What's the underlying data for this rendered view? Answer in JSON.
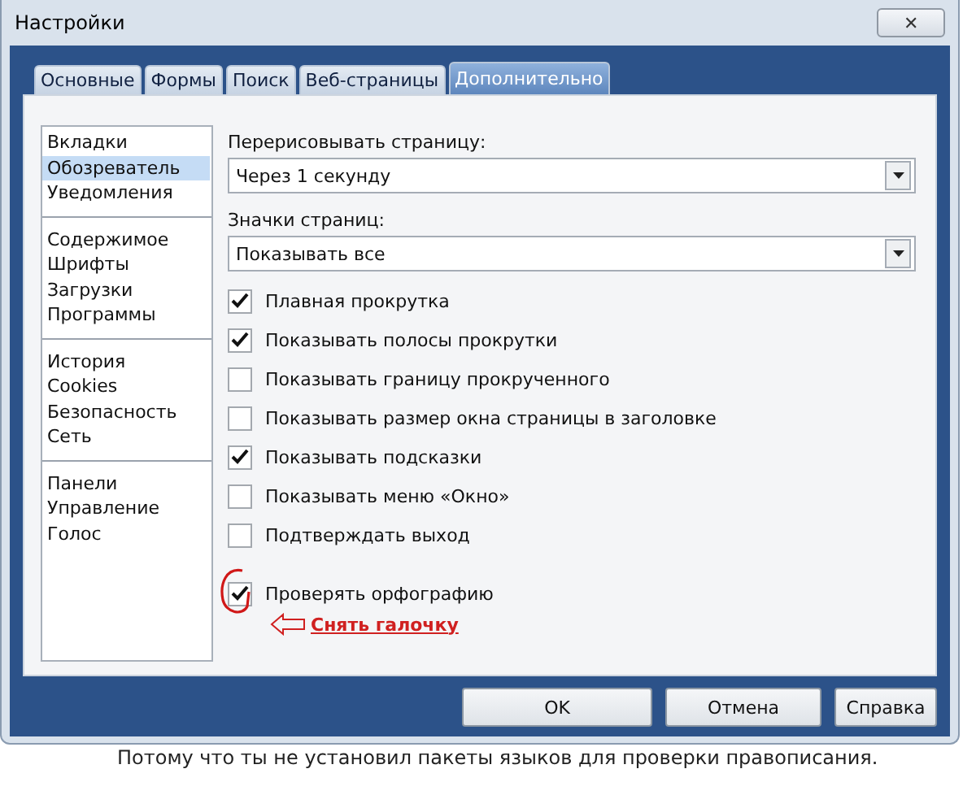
{
  "window": {
    "title": "Настройки",
    "close": "✕"
  },
  "tabs": [
    {
      "label": "Основные",
      "selected": false
    },
    {
      "label": "Формы",
      "selected": false
    },
    {
      "label": "Поиск",
      "selected": false
    },
    {
      "label": "Веб-страницы",
      "selected": false
    },
    {
      "label": "Дополнительно",
      "selected": true
    }
  ],
  "sidebar": {
    "groups": [
      [
        {
          "label": "Вкладки",
          "selected": false
        },
        {
          "label": "Обозреватель",
          "selected": true
        },
        {
          "label": "Уведомления",
          "selected": false
        }
      ],
      [
        {
          "label": "Содержимое",
          "selected": false
        },
        {
          "label": "Шрифты",
          "selected": false
        },
        {
          "label": "Загрузки",
          "selected": false
        },
        {
          "label": "Программы",
          "selected": false
        }
      ],
      [
        {
          "label": "История",
          "selected": false
        },
        {
          "label": "Cookies",
          "selected": false
        },
        {
          "label": "Безопасность",
          "selected": false
        },
        {
          "label": "Сеть",
          "selected": false
        }
      ],
      [
        {
          "label": "Панели",
          "selected": false
        },
        {
          "label": "Управление",
          "selected": false
        },
        {
          "label": "Голос",
          "selected": false
        }
      ]
    ]
  },
  "dropdowns": [
    {
      "label": "Перерисовывать страницу:",
      "value": "Через 1 секунду"
    },
    {
      "label": "Значки страниц:",
      "value": "Показывать все"
    }
  ],
  "checkboxes": [
    {
      "label": "Плавная прокрутка",
      "checked": true,
      "circled": false
    },
    {
      "label": "Показывать полосы прокрутки",
      "checked": true,
      "circled": false
    },
    {
      "label": "Показывать границу прокрученного",
      "checked": false,
      "circled": false
    },
    {
      "label": "Показывать размер окна страницы в заголовке",
      "checked": false,
      "circled": false
    },
    {
      "label": "Показывать подсказки",
      "checked": true,
      "circled": false
    },
    {
      "label": "Показывать меню «Окно»",
      "checked": false,
      "circled": false
    },
    {
      "label": "Подтверждать выход",
      "checked": false,
      "circled": false
    },
    {
      "label": "Проверять орфографию",
      "checked": true,
      "circled": true
    }
  ],
  "annotation": "Снять галочку",
  "buttons": [
    "OK",
    "Отмена",
    "Справка"
  ],
  "caption": "Потому что ты не установил пакеты языков для проверки правописания."
}
